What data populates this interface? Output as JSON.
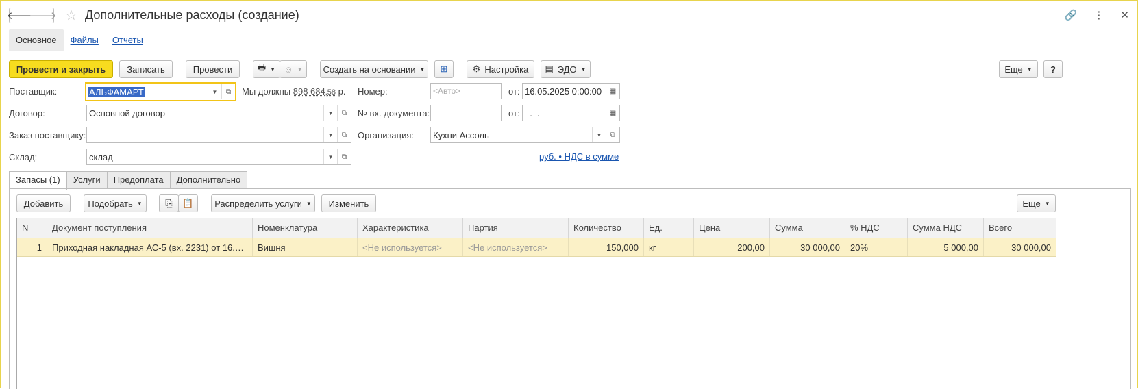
{
  "window": {
    "title": "Дополнительные расходы (создание)"
  },
  "section_tabs": [
    "Основное",
    "Файлы",
    "Отчеты"
  ],
  "toolbar": {
    "post_close": "Провести и закрыть",
    "save": "Записать",
    "post": "Провести",
    "create_based": "Создать на основании",
    "settings": "Настройка",
    "edo": "ЭДО",
    "more": "Еще",
    "help": "?"
  },
  "form": {
    "supplier_label": "Поставщик:",
    "supplier_value": "АЛЬФАМАРТ",
    "debt_prefix": "Мы должны",
    "debt_amount": "898 684",
    "debt_cents": ",58",
    "debt_currency": "р.",
    "contract_label": "Договор:",
    "contract_value": "Основной договор",
    "order_label": "Заказ поставщику:",
    "order_value": "",
    "warehouse_label": "Склад:",
    "warehouse_value": "склад",
    "number_label": "Номер:",
    "number_placeholder": "<Авто>",
    "date_from_label": "от:",
    "date_value": "16.05.2025  0:00:00",
    "in_doc_label": "№ вх. документа:",
    "in_doc_value": "",
    "in_doc_from_label": "от:",
    "in_doc_date": "  .  .",
    "org_label": "Организация:",
    "org_value": "Кухни Ассоль",
    "currency_link": "руб. • НДС в сумме"
  },
  "tabs": [
    "Запасы (1)",
    "Услуги",
    "Предоплата",
    "Дополнительно"
  ],
  "table_toolbar": {
    "add": "Добавить",
    "pick": "Подобрать",
    "distribute": "Распределить услуги",
    "change": "Изменить",
    "more": "Еще"
  },
  "table": {
    "columns": [
      "N",
      "Документ поступления",
      "Номенклатура",
      "Характеристика",
      "Партия",
      "Количество",
      "Ед.",
      "Цена",
      "Сумма",
      "% НДС",
      "Сумма НДС",
      "Всего"
    ],
    "rows": [
      [
        "1",
        "Приходная накладная АС-5 (вх. 2231) от 16.05....",
        "Вишня",
        "<Не используется>",
        "<Не используется>",
        "150,000",
        "кг",
        "200,00",
        "30 000,00",
        "20%",
        "5 000,00",
        "30 000,00"
      ]
    ]
  },
  "colors": {
    "accent": "#f7dc1f",
    "link": "#1a56b0",
    "row_selected": "#fbf1c7"
  }
}
